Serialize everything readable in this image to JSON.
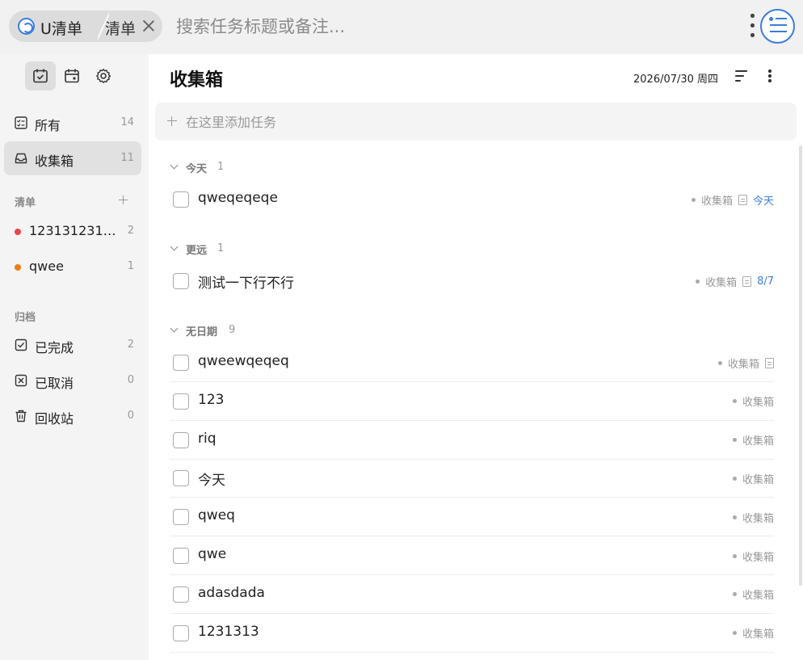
{
  "colors": {
    "accent": "#3b7ddd",
    "list_red": "#e84646",
    "list_orange": "#f07d18"
  },
  "titlebar": {
    "app_tab_label": "U清单",
    "list_tab_label": "清单",
    "search_placeholder": "搜索任务标题或备注..."
  },
  "sidebar": {
    "nav": [
      {
        "label": "所有",
        "count": "14",
        "icon": "checklist-icon"
      },
      {
        "label": "收集箱",
        "count": "11",
        "icon": "inbox-icon"
      }
    ],
    "lists_title": "清单",
    "lists": [
      {
        "label": "1231312314...",
        "count": "2",
        "color": "#e84646"
      },
      {
        "label": "qwee",
        "count": "1",
        "color": "#f07d18"
      }
    ],
    "archive_title": "归档",
    "archive": [
      {
        "label": "已完成",
        "count": "2",
        "icon": "check-square-icon"
      },
      {
        "label": "已取消",
        "count": "0",
        "icon": "x-square-icon"
      },
      {
        "label": "回收站",
        "count": "0",
        "icon": "trash-icon"
      }
    ]
  },
  "main": {
    "title": "收集箱",
    "date": "2026/07/30 周四",
    "add_placeholder": "在这里添加任务",
    "groups": [
      {
        "label": "今天",
        "count": "1",
        "tasks": [
          {
            "title": "qweqeqeqe",
            "list": "收集箱",
            "has_note": true,
            "due": "今天"
          }
        ]
      },
      {
        "label": "更远",
        "count": "1",
        "tasks": [
          {
            "title": "测试一下行不行",
            "list": "收集箱",
            "has_note": true,
            "due": "8/7"
          }
        ]
      },
      {
        "label": "无日期",
        "count": "9",
        "tasks": [
          {
            "title": "qweewqeqeq",
            "list": "收集箱",
            "has_note": true,
            "due": ""
          },
          {
            "title": "123",
            "list": "收集箱",
            "has_note": false,
            "due": ""
          },
          {
            "title": "riq",
            "list": "收集箱",
            "has_note": false,
            "due": ""
          },
          {
            "title": "今天",
            "list": "收集箱",
            "has_note": false,
            "due": ""
          },
          {
            "title": "qweq",
            "list": "收集箱",
            "has_note": false,
            "due": ""
          },
          {
            "title": "qwe",
            "list": "收集箱",
            "has_note": false,
            "due": ""
          },
          {
            "title": "adasdada",
            "list": "收集箱",
            "has_note": false,
            "due": ""
          },
          {
            "title": "1231313",
            "list": "收集箱",
            "has_note": false,
            "due": ""
          }
        ]
      }
    ]
  }
}
